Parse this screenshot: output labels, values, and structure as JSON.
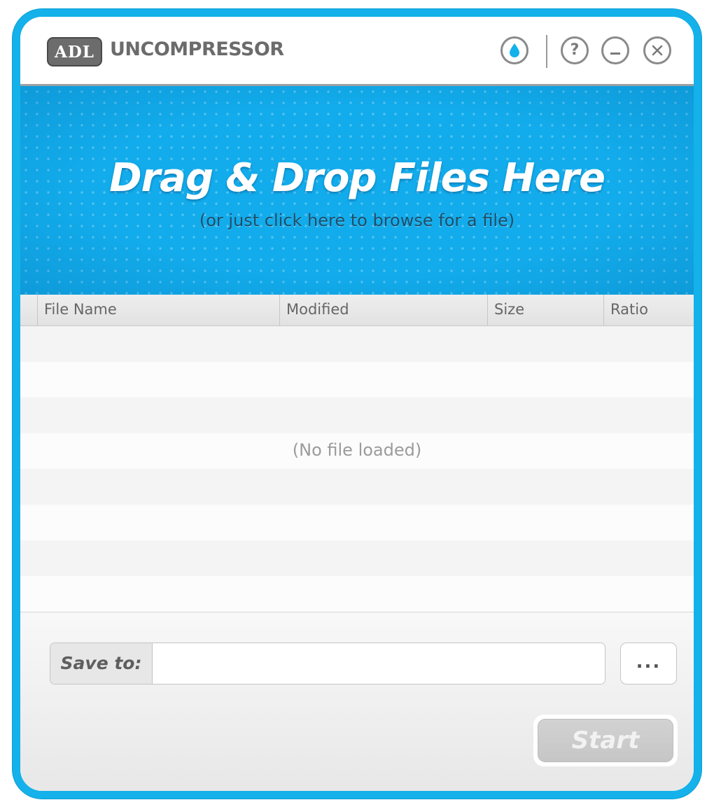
{
  "app": {
    "logo_text": "ADL",
    "name": "UNCOMPRESSOR"
  },
  "titlebar": {
    "buttons": [
      {
        "name": "skin-icon",
        "glyph": "💧"
      },
      {
        "name": "help-icon",
        "glyph": "?"
      },
      {
        "name": "minimize-icon",
        "glyph": "–"
      },
      {
        "name": "close-icon",
        "glyph": "×"
      }
    ]
  },
  "dropzone": {
    "title": "Drag & Drop Files Here",
    "subtitle": "(or just click here to browse for a file)"
  },
  "table": {
    "columns": [
      "File Name",
      "Modified",
      "Size",
      "Ratio"
    ],
    "empty_text": "(No file loaded)"
  },
  "save": {
    "label": "Save to:",
    "value": "",
    "browse_label": "..."
  },
  "start_label": "Start",
  "colors": {
    "accent": "#14b1ea",
    "dropzone": "#12acec"
  }
}
